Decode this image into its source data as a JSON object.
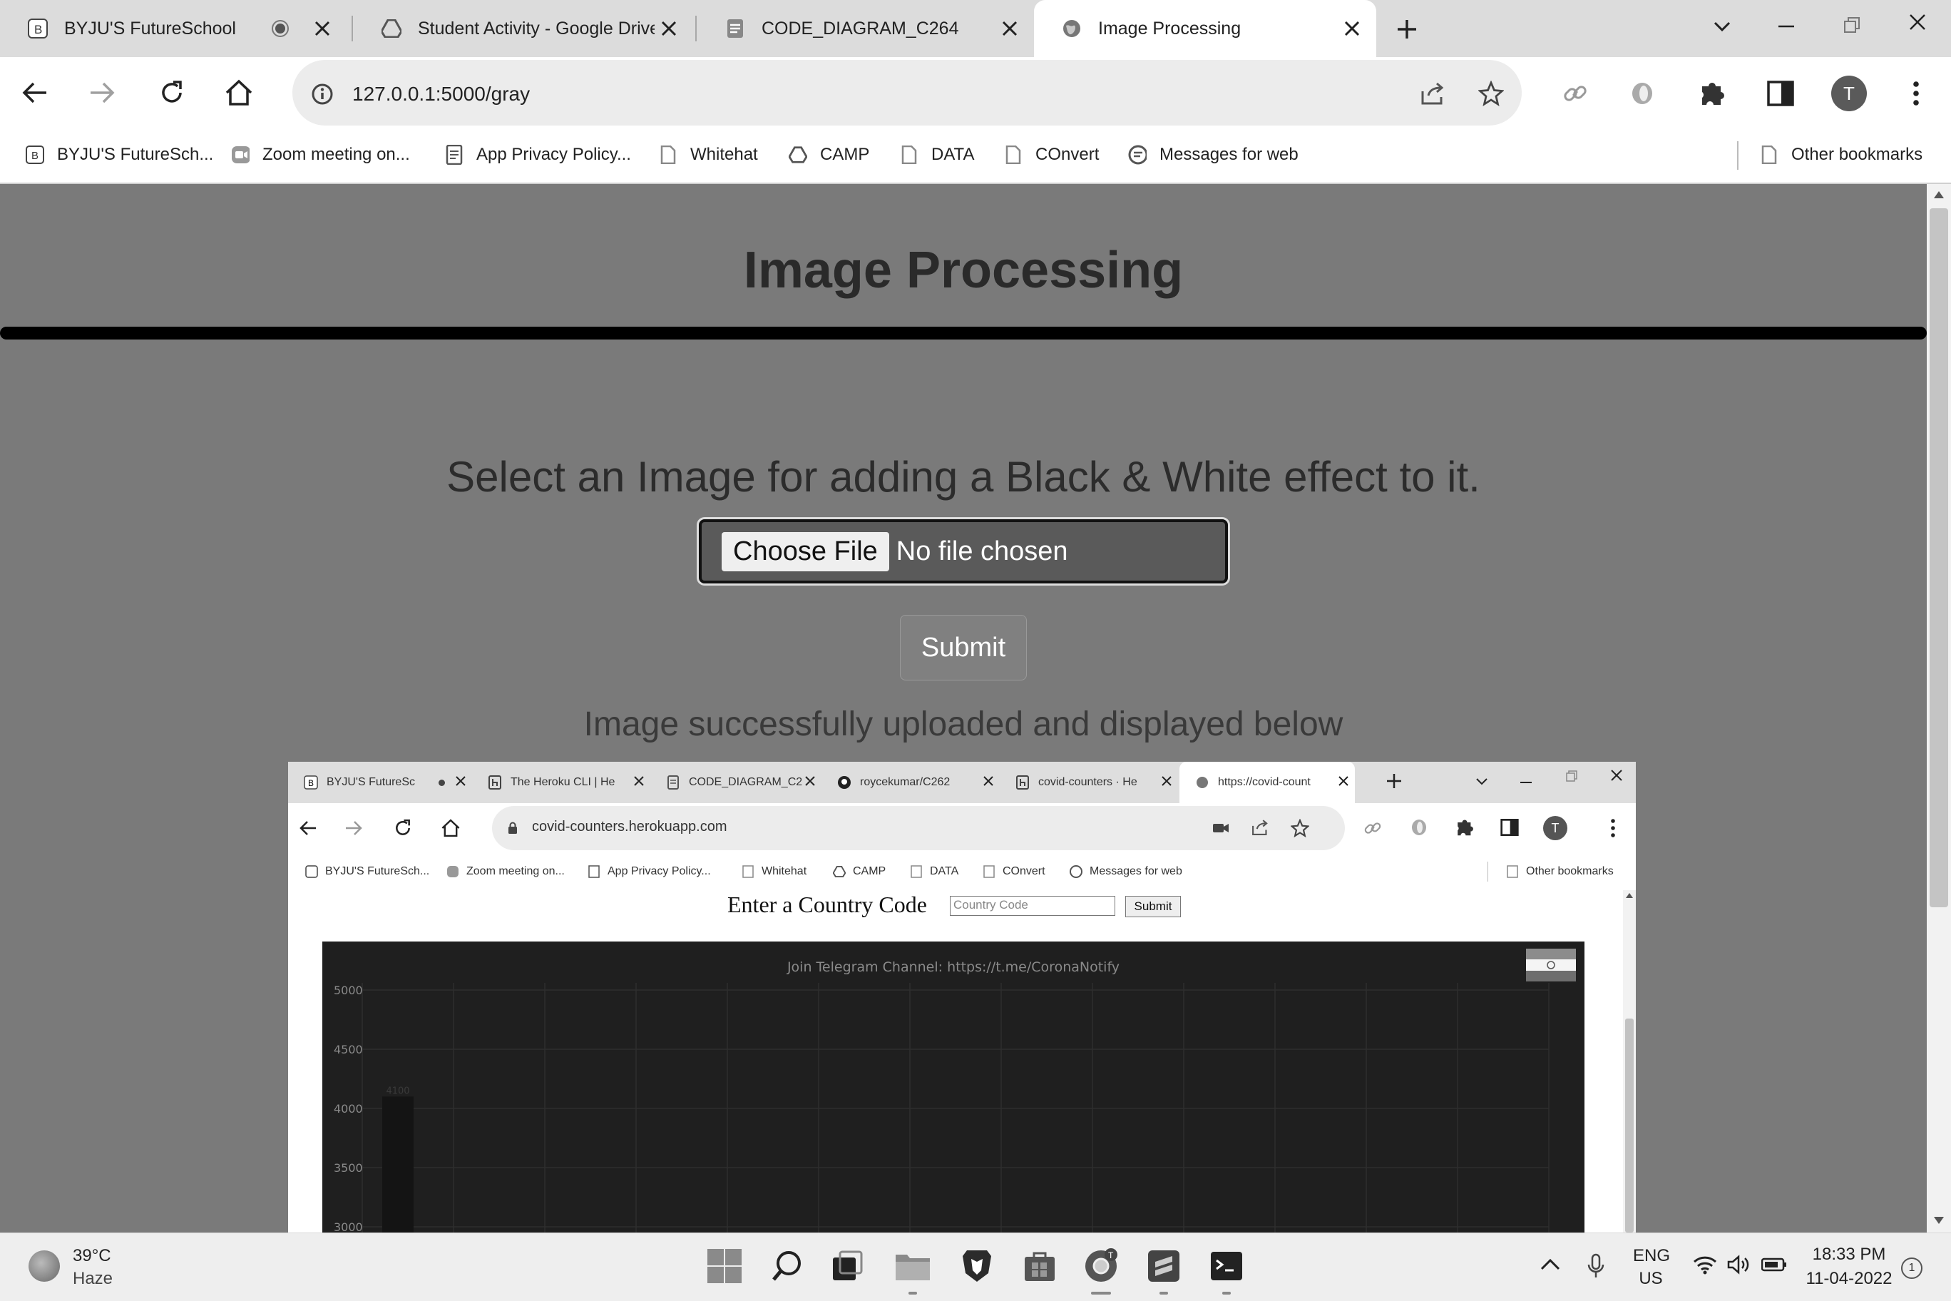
{
  "browser": {
    "tabs": [
      {
        "title": "BYJU'S FutureSchool",
        "icon": "byjus-favicon",
        "status": "audio-dot"
      },
      {
        "title": "Student Activity - Google Drive",
        "icon": "google-drive-icon"
      },
      {
        "title": "CODE_DIAGRAM_C264",
        "icon": "docs-icon"
      },
      {
        "title": "Image Processing",
        "icon": "globe-icon",
        "active": true
      }
    ],
    "address": "127.0.0.1:5000/gray",
    "bookmarks": [
      {
        "label": "BYJU'S FutureSch...",
        "icon": "byjus-favicon"
      },
      {
        "label": "Zoom meeting on...",
        "icon": "zoom-icon"
      },
      {
        "label": "App Privacy Policy...",
        "icon": "page-icon"
      },
      {
        "label": "Whitehat",
        "icon": "page-icon"
      },
      {
        "label": "CAMP",
        "icon": "google-drive-icon"
      },
      {
        "label": "DATA",
        "icon": "page-icon"
      },
      {
        "label": "COnvert",
        "icon": "page-icon"
      },
      {
        "label": "Messages for web",
        "icon": "messages-icon"
      }
    ],
    "other_bookmarks": "Other bookmarks",
    "profile_initial": "T"
  },
  "page": {
    "title": "Image Processing",
    "prompt": "Select an Image for adding a Black & White effect to it.",
    "file_button": "Choose File",
    "file_status": "No file chosen",
    "submit": "Submit",
    "success": "Image successfully uploaded and displayed below"
  },
  "inner": {
    "tabs": [
      {
        "title": "BYJU'S FutureSc",
        "icon": "byjus-favicon"
      },
      {
        "title": "The Heroku CLI | He",
        "icon": "heroku-icon"
      },
      {
        "title": "CODE_DIAGRAM_C2",
        "icon": "docs-icon"
      },
      {
        "title": "roycekumar/C262",
        "icon": "github-icon"
      },
      {
        "title": "covid-counters · He",
        "icon": "heroku-icon"
      },
      {
        "title": "https://covid-count",
        "icon": "globe-icon",
        "active": true
      }
    ],
    "address": "covid-counters.herokuapp.com",
    "bookmarks": [
      {
        "label": "BYJU'S FutureSch...",
        "icon": "byjus-favicon"
      },
      {
        "label": "Zoom meeting on...",
        "icon": "zoom-icon"
      },
      {
        "label": "App Privacy Policy...",
        "icon": "page-icon"
      },
      {
        "label": "Whitehat",
        "icon": "page-icon"
      },
      {
        "label": "CAMP",
        "icon": "google-drive-icon"
      },
      {
        "label": "DATA",
        "icon": "page-icon"
      },
      {
        "label": "COnvert",
        "icon": "page-icon"
      },
      {
        "label": "Messages for web",
        "icon": "messages-icon"
      }
    ],
    "other_bookmarks": "Other bookmarks",
    "profile_initial": "T",
    "form_label": "Enter a Country Code",
    "input_placeholder": "Country Code",
    "submit": "Submit"
  },
  "chart_data": {
    "type": "bar",
    "title": "Join Telegram Channel: https://t.me/CoronaNotify",
    "y_ticks": [
      "5000",
      "4500",
      "4000",
      "3500",
      "3000"
    ],
    "ylim": [
      3000,
      5000
    ],
    "grid": true,
    "series": [
      {
        "values": [
          4100
        ],
        "data_labels": [
          "4100"
        ]
      }
    ],
    "colors": {
      "background": "#1f1f1f",
      "bar": "#141414",
      "grid": "#2e2e2e",
      "text": "#8a8a8a"
    }
  },
  "taskbar": {
    "weather_temp": "39°C",
    "weather_desc": "Haze",
    "lang_top": "ENG",
    "lang_bottom": "US",
    "time": "18:33 PM",
    "date": "11-04-2022",
    "notification_count": "1",
    "apps": [
      "windows-start-icon",
      "search-icon",
      "task-view-icon",
      "file-explorer-icon",
      "brave-icon",
      "store-icon",
      "chrome-icon",
      "sublime-icon",
      "terminal-icon"
    ]
  }
}
